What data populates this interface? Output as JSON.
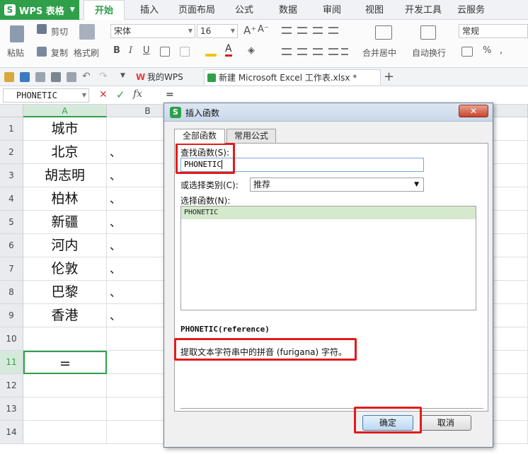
{
  "app": {
    "logo": "WPS 表格"
  },
  "menu": {
    "tabs": [
      "开始",
      "插入",
      "页面布局",
      "公式",
      "数据",
      "审阅",
      "视图",
      "开发工具",
      "云服务"
    ],
    "active": "开始"
  },
  "ribbon": {
    "paste": "粘贴",
    "cut": "剪切",
    "copy": "复制",
    "format_painter": "格式刷",
    "font_name": "宋体",
    "font_size": "16",
    "bold": "B",
    "italic": "I",
    "underline": "U",
    "merge_center": "合并居中",
    "wrap_text": "自动换行",
    "number_format": "常规",
    "percent": "%"
  },
  "doc_tabs": {
    "home": "我的WPS",
    "active": "新建 Microsoft Excel 工作表.xlsx *",
    "add": "+"
  },
  "formula_bar": {
    "name_box": "PHONETIC",
    "cancel": "✕",
    "confirm": "✓",
    "fx": "fx",
    "content": "="
  },
  "sheet": {
    "columns": [
      "A",
      "B"
    ],
    "rows": [
      {
        "num": "1",
        "a": "城市",
        "b": ""
      },
      {
        "num": "2",
        "a": "北京",
        "b": "、"
      },
      {
        "num": "3",
        "a": "胡志明",
        "b": "、"
      },
      {
        "num": "4",
        "a": "柏林",
        "b": "、"
      },
      {
        "num": "5",
        "a": "新疆",
        "b": "、"
      },
      {
        "num": "6",
        "a": "河内",
        "b": "、"
      },
      {
        "num": "7",
        "a": "伦敦",
        "b": "、"
      },
      {
        "num": "8",
        "a": "巴黎",
        "b": "、"
      },
      {
        "num": "9",
        "a": "香港",
        "b": "、"
      },
      {
        "num": "10",
        "a": "",
        "b": ""
      },
      {
        "num": "11",
        "a": "=",
        "b": ""
      },
      {
        "num": "12",
        "a": "",
        "b": ""
      },
      {
        "num": "13",
        "a": "",
        "b": ""
      },
      {
        "num": "14",
        "a": "",
        "b": ""
      }
    ],
    "active_row": "11"
  },
  "dialog": {
    "title": "插入函数",
    "close": "✕",
    "tabs": [
      "全部函数",
      "常用公式"
    ],
    "search_label": "查找函数(S):",
    "search_value": "PHONETIC",
    "category_label": "或选择类别(C):",
    "category_value": "推荐",
    "list_label": "选择函数(N):",
    "functions": [
      "PHONETIC"
    ],
    "signature": "PHONETIC(reference)",
    "description": "提取文本字符串中的拼音 (furigana) 字符。",
    "ok": "确定",
    "cancel": "取消"
  },
  "colors": {
    "accent": "#2f9f4a",
    "highlight": "#e21b1b"
  }
}
